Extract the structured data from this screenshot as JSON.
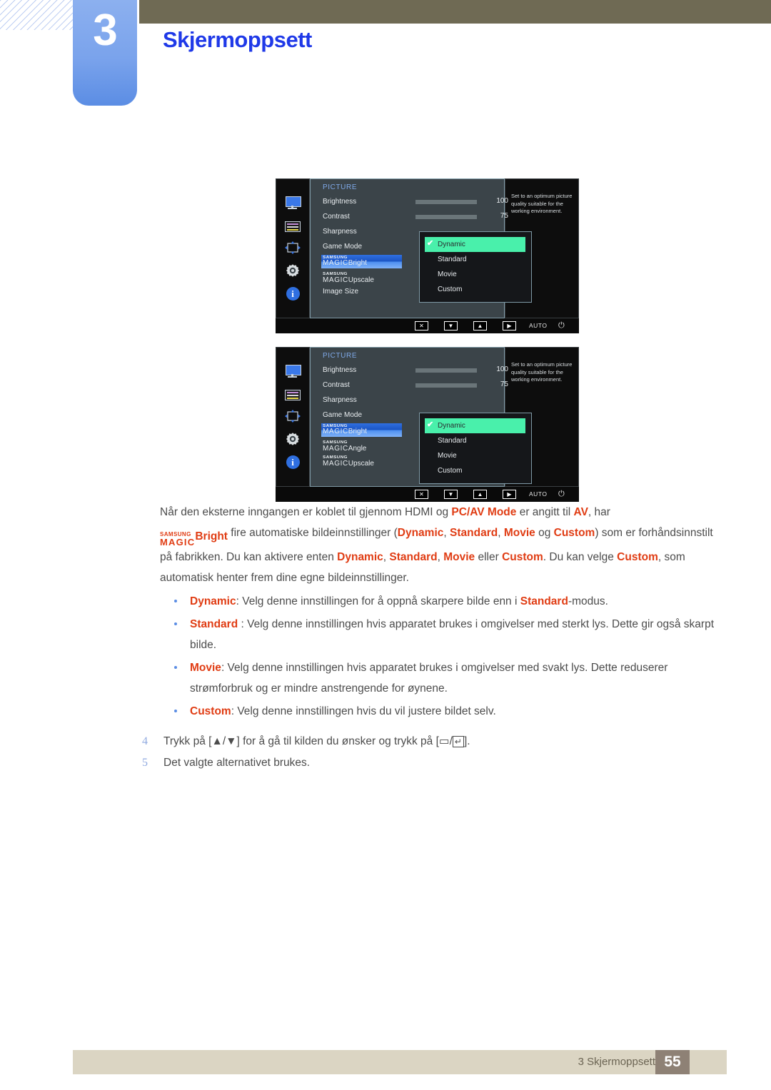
{
  "header": {
    "chapter_number": "3",
    "chapter_title": "Skjermoppsett"
  },
  "osd_screens": [
    {
      "heading": "PICTURE",
      "sidebar_icons": [
        "monitor-icon",
        "color-list-icon",
        "position-arrows-icon",
        "gear-icon",
        "info-icon"
      ],
      "rows": [
        {
          "label": "Brightness",
          "value": "100",
          "slider": 100,
          "type": "slider"
        },
        {
          "label": "Contrast",
          "value": "75",
          "slider": 75,
          "type": "slider"
        },
        {
          "label": "Sharpness",
          "type": "plain"
        },
        {
          "label": "Game Mode",
          "type": "plain"
        },
        {
          "label": "Bright",
          "type": "magic",
          "highlighted": true
        },
        {
          "label": "Upscale",
          "type": "magic"
        },
        {
          "label": "Image Size",
          "type": "plain"
        }
      ],
      "submenu": {
        "options": [
          "Dynamic",
          "Standard",
          "Movie",
          "Custom"
        ],
        "selected": "Dynamic",
        "check_glyph": "✔"
      },
      "description": "Set to an optimum picture quality suitable for the working environment.",
      "buttons": {
        "close": "✕",
        "down": "▼",
        "up": "▲",
        "right": "▶",
        "auto": "AUTO",
        "power": "⏻"
      }
    },
    {
      "heading": "PICTURE",
      "sidebar_icons": [
        "monitor-icon",
        "color-list-icon",
        "position-arrows-icon",
        "gear-icon",
        "info-icon"
      ],
      "rows": [
        {
          "label": "Brightness",
          "value": "100",
          "slider": 100,
          "type": "slider"
        },
        {
          "label": "Contrast",
          "value": "75",
          "slider": 75,
          "type": "slider"
        },
        {
          "label": "Sharpness",
          "type": "plain"
        },
        {
          "label": "Game Mode",
          "type": "plain"
        },
        {
          "label": "Bright",
          "type": "magic",
          "highlighted": true
        },
        {
          "label": "Angle",
          "type": "magic"
        },
        {
          "label": "Upscale",
          "type": "magic"
        }
      ],
      "submenu": {
        "options": [
          "Dynamic",
          "Standard",
          "Movie",
          "Custom"
        ],
        "selected": "Dynamic",
        "check_glyph": "✔"
      },
      "description": "Set to an optimum picture quality suitable for the working environment.",
      "buttons": {
        "close": "✕",
        "down": "▼",
        "up": "▲",
        "right": "▶",
        "auto": "AUTO",
        "power": "⏻"
      }
    }
  ],
  "magic_brand": {
    "top": "SAMSUNG",
    "bottom": "MAGIC"
  },
  "body": {
    "paragraph_1_a": "Når den eksterne inngangen er koblet til gjennom HDMI og ",
    "paragraph_1_kw1": "PC/AV Mode",
    "paragraph_1_b": " er angitt til ",
    "paragraph_1_kw2": "AV",
    "paragraph_1_c": ", har ",
    "paragraph_2_bright": "Bright",
    "paragraph_2_a": " fire automatiske bildeinnstillinger (",
    "paragraph_2_kw1": "Dynamic",
    "paragraph_2_sep1": ", ",
    "paragraph_2_kw2": "Standard",
    "paragraph_2_sep2": ", ",
    "paragraph_2_kw3": "Movie",
    "paragraph_2_sep3": " og ",
    "paragraph_2_kw4": "Custom",
    "paragraph_2_b": ") som er forhåndsinnstilt på fabrikken. Du kan aktivere enten ",
    "paragraph_2_kw5": "Dynamic",
    "paragraph_2_sep4": ", ",
    "paragraph_2_kw6": "Standard",
    "paragraph_2_sep5": ", ",
    "paragraph_2_kw7": "Movie",
    "paragraph_2_sep6": " eller ",
    "paragraph_2_kw8": "Custom",
    "paragraph_2_c": ". Du kan velge ",
    "paragraph_2_kw9": "Custom",
    "paragraph_2_d": ", som automatisk henter frem dine egne bildeinnstillinger."
  },
  "bullets": [
    {
      "term": "Dynamic",
      "text_a": ": Velg denne innstillingen for å oppnå skarpere bilde enn i ",
      "term2": "Standard",
      "text_b": "-modus."
    },
    {
      "term": "Standard",
      "text_a": " : Velg denne innstillingen hvis apparatet brukes i omgivelser med sterkt lys. Dette gir også skarpt bilde.",
      "term2": "",
      "text_b": ""
    },
    {
      "term": "Movie",
      "text_a": ": Velg denne innstillingen hvis apparatet brukes i omgivelser med svakt lys. Dette reduserer strømforbruk og er mindre anstrengende for øynene.",
      "term2": "",
      "text_b": ""
    },
    {
      "term": "Custom",
      "text_a": ": Velg denne innstillingen hvis du vil justere bildet selv.",
      "term2": "",
      "text_b": ""
    }
  ],
  "steps": [
    {
      "number": "4",
      "text_a": "Trykk på [",
      "glyph_up": "▲",
      "slash1": "/",
      "glyph_down": "▼",
      "text_b": "] for å gå til kilden du ønsker og trykk på [",
      "glyph_menu": "▭",
      "slash2": "/",
      "glyph_enter": "↵",
      "text_c": "]."
    },
    {
      "number": "5",
      "text_a": "Det valgte alternativet brukes.",
      "glyph_up": "",
      "slash1": "",
      "glyph_down": "",
      "text_b": "",
      "glyph_menu": "",
      "slash2": "",
      "glyph_enter": "",
      "text_c": ""
    }
  ],
  "footer": {
    "label": "3 Skjermoppsett",
    "page": "55"
  },
  "colors": {
    "accent_blue": "#1f39e8",
    "keyword_orange": "#e03c13",
    "tab_blue": "#7aa3ec",
    "topbar_olive": "#6f6a54",
    "footer_beige": "#dbd5c3",
    "footer_page_brown": "#8e8175",
    "osd_select_green": "#49f0ab",
    "osd_highlight_blue": "#2f6fe0"
  }
}
